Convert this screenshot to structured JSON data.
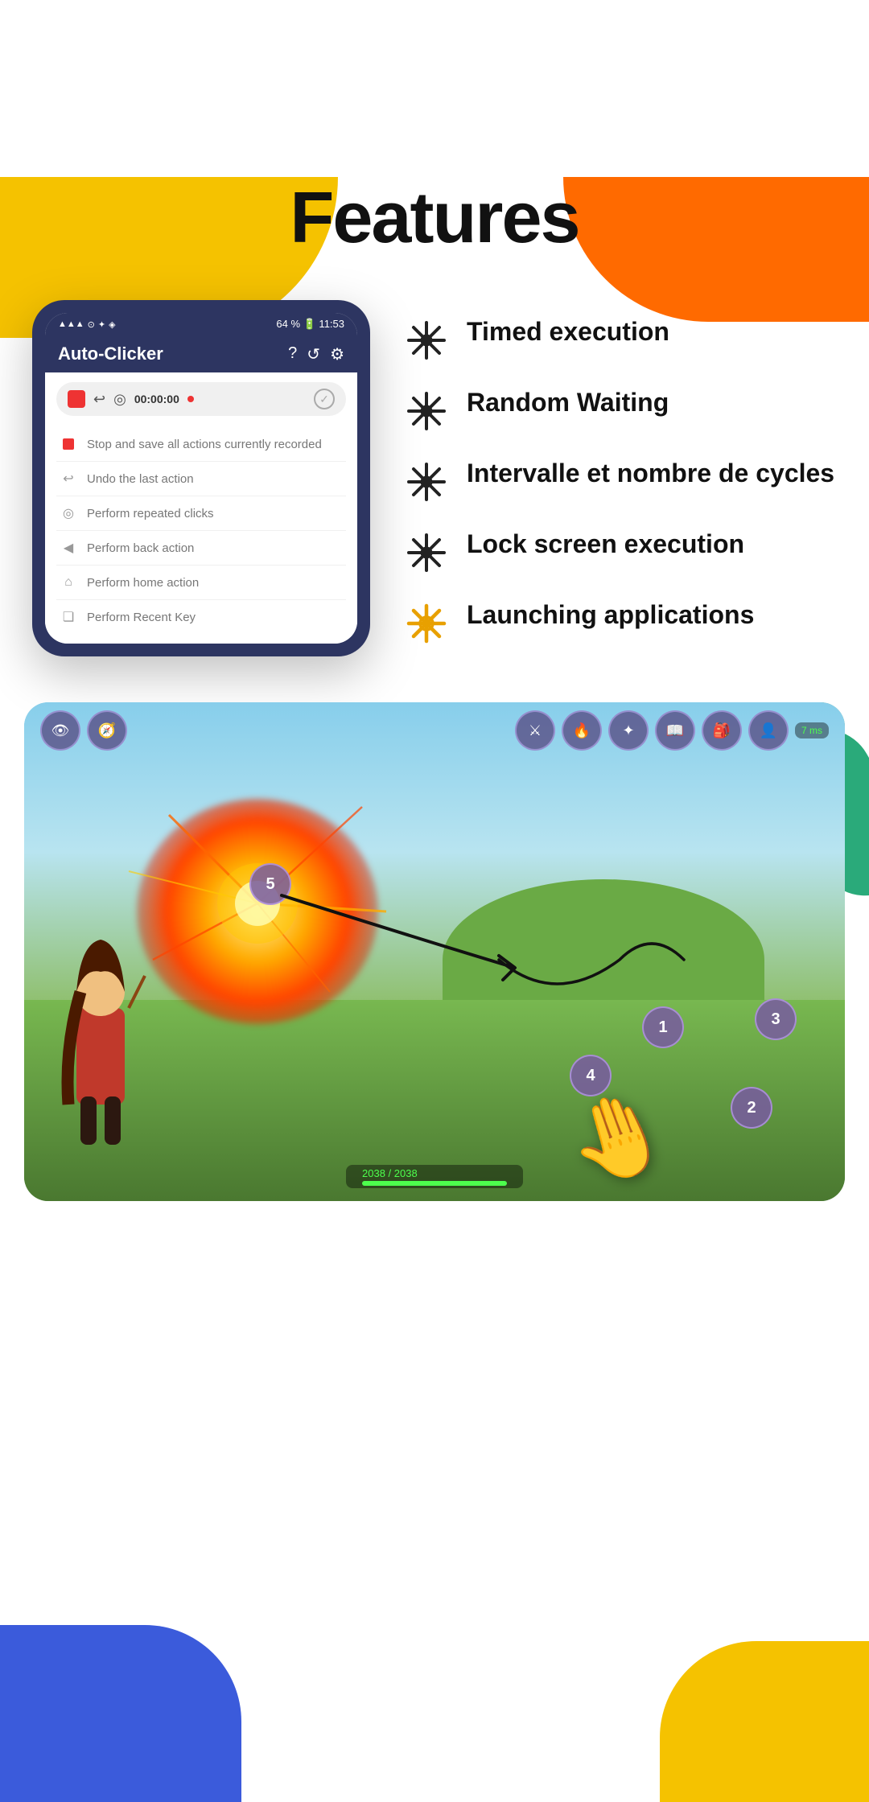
{
  "page": {
    "title": "Features",
    "background_color": "#ffffff"
  },
  "decorations": {
    "blob_top_left_color": "#f5c200",
    "blob_top_right_color": "#ff6a00",
    "blob_mid_right_color": "#2aaa7a",
    "blob_yellow_mid_color": "#f5c200",
    "blob_bottom_left_color": "#3b5bdb",
    "blob_bottom_right_color": "#f5c200"
  },
  "phone": {
    "app_name": "Auto-Clicker",
    "statusbar": {
      "left": "📶 ⚡ ◎ ✦",
      "right": "64 % 🔋 11:53"
    },
    "header_icons": [
      "?",
      "↺",
      "⚙"
    ],
    "recording_bar": {
      "time": "00:00:00"
    },
    "menu_items": [
      {
        "icon": "stop",
        "label": "Stop and save all actions currently recorded"
      },
      {
        "icon": "undo",
        "label": "Undo the last action"
      },
      {
        "icon": "target",
        "label": "Perform repeated clicks"
      },
      {
        "icon": "back",
        "label": "Perform back action"
      },
      {
        "icon": "home",
        "label": "Perform home action"
      },
      {
        "icon": "recent",
        "label": "Perform Recent Key"
      }
    ]
  },
  "features": [
    {
      "id": "timed",
      "text": "Timed execution"
    },
    {
      "id": "random",
      "text": "Random Waiting"
    },
    {
      "id": "interval",
      "text": "Intervalle et nombre de cycles"
    },
    {
      "id": "lock",
      "text": "Lock screen execution"
    },
    {
      "id": "launch",
      "text": "Launching applications"
    }
  ],
  "game": {
    "ping": "7 ms",
    "health": "2038 / 2038",
    "circles": [
      "5",
      "4",
      "3",
      "2",
      "1"
    ]
  }
}
